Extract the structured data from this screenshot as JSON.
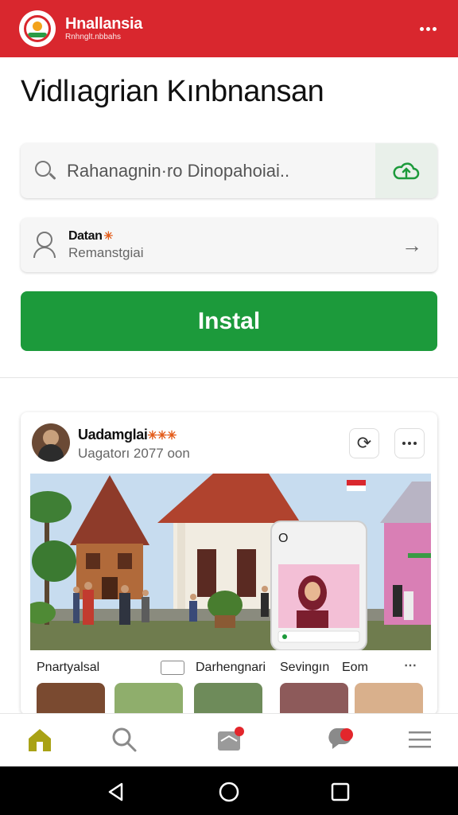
{
  "header": {
    "brand_title": "Hnallansia",
    "brand_subtitle": "Rnhnglt.nbbahs",
    "menu_icon": "more-horizontal-icon",
    "color": "#d9272e"
  },
  "page": {
    "title": "Vidlıagrian Kınbnansan"
  },
  "search": {
    "text": "Rahanagnin·ro Dinopahoiai..",
    "action_icon": "cloud-upload-icon"
  },
  "account": {
    "title": "Datan",
    "badge": "✳",
    "subtitle": "Remanstgiai",
    "arrow_icon": "arrow-right-icon"
  },
  "install": {
    "label": "Instal",
    "color": "#1c9a3b"
  },
  "post": {
    "author": "Uadamglai",
    "badges": "✳✳✳",
    "meta": "Uagatorı 2077 oon",
    "refresh_icon": "refresh-icon",
    "more_icon": "more-horizontal-icon",
    "captions": [
      "Pnartyalsal",
      "Darhengnari",
      "Sevingın",
      "Eom"
    ],
    "overlay_phone_top": "O"
  },
  "bottom_nav": {
    "items": [
      "home-icon",
      "search-icon",
      "inbox-icon",
      "chat-icon",
      "menu-icon"
    ]
  },
  "system_nav": {
    "items": [
      "back-icon",
      "home-circle-icon",
      "recents-icon"
    ]
  }
}
